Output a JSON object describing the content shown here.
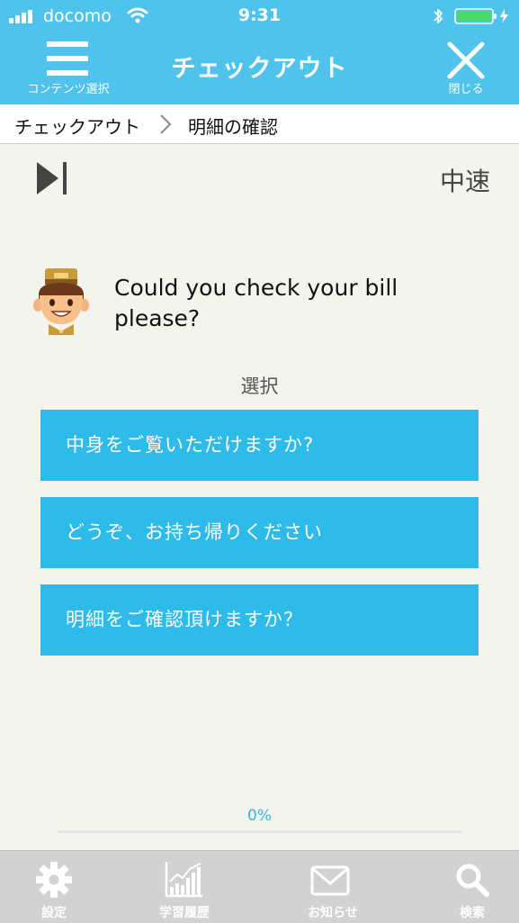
{
  "status_bar": {
    "carrier": "docomo",
    "time": "9:31"
  },
  "nav": {
    "title": "チェックアウト",
    "menu_label": "コンテンツ選択",
    "close_label": "閉じる"
  },
  "breadcrumb": {
    "items": [
      "チェックアウト",
      "明細の確認"
    ]
  },
  "controls": {
    "speed": "中速"
  },
  "question": {
    "text": "Could you check your bill please?"
  },
  "choices": {
    "label": "選択",
    "options": [
      "中身をご覧いただけますか?",
      "どうぞ、お持ち帰りください",
      "明細をご確認頂けますか？"
    ]
  },
  "progress": {
    "label": "0%",
    "value": 0
  },
  "tabs": [
    {
      "label": "設定",
      "icon": "gear-icon"
    },
    {
      "label": "学習履歴",
      "icon": "chart-icon"
    },
    {
      "label": "お知らせ",
      "icon": "mail-icon"
    },
    {
      "label": "検索",
      "icon": "search-icon"
    }
  ],
  "colors": {
    "header": "#4fc3ec",
    "option": "#2ebbea",
    "background": "#f4f4ec",
    "battery": "#4cd964",
    "tab_bar": "#d2d2d2"
  }
}
